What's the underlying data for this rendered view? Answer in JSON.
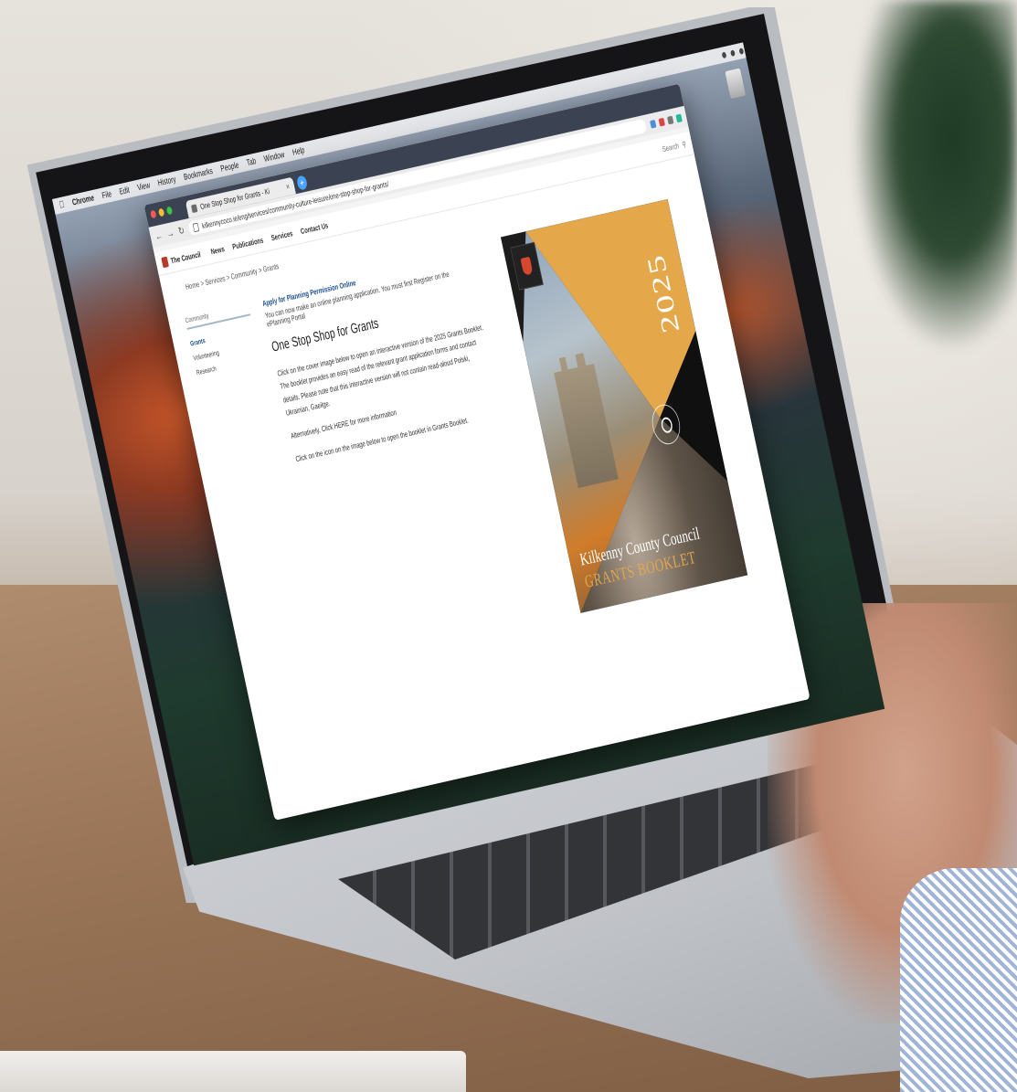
{
  "menubar": {
    "app_name": "Chrome",
    "items": [
      "File",
      "Edit",
      "View",
      "History",
      "Bookmarks",
      "People",
      "Tab",
      "Window",
      "Help"
    ]
  },
  "browser": {
    "tab_title": "One Stop Shop for Grants - Ki",
    "url": "kilkennycoco.ie/eng/services/community-culture-leisure/one-stop-shop-for-grants/"
  },
  "site": {
    "brand": "The Council",
    "nav": [
      "News",
      "Publications",
      "Services",
      "Contact Us"
    ],
    "search_label": "Search",
    "breadcrumb": "Home > Services > Community > Grants"
  },
  "sidenav": {
    "header": "Community",
    "items": [
      "Grants",
      "Volunteering",
      "Research"
    ]
  },
  "main": {
    "intro_link": "Apply for Planning Permission Online",
    "intro_text": "You can now make an online planning application. You must first Register on the ePlanning Portal",
    "heading": "One Stop Shop for Grants",
    "p1": "Click on the cover image below to open an interactive version of the 2025 Grants Booklet. The booklet provides an easy read of the relevant grant application forms and contact details. Please note that this interactive version will not contain read-aloud Polski, Ukrainian, Gaeilge.",
    "p2": "Alternatively, Click HERE for more information",
    "p3": "Click on the icon on the image below to open the booklet in Grants Booklet."
  },
  "booklet": {
    "year": "2025",
    "title_line1": "Kilkenny County Council",
    "title_line2": "GRANTS BOOKLET"
  },
  "colors": {
    "gold": "#e4a749",
    "tabstrip": "#3b4251",
    "link": "#1a4d8a"
  }
}
